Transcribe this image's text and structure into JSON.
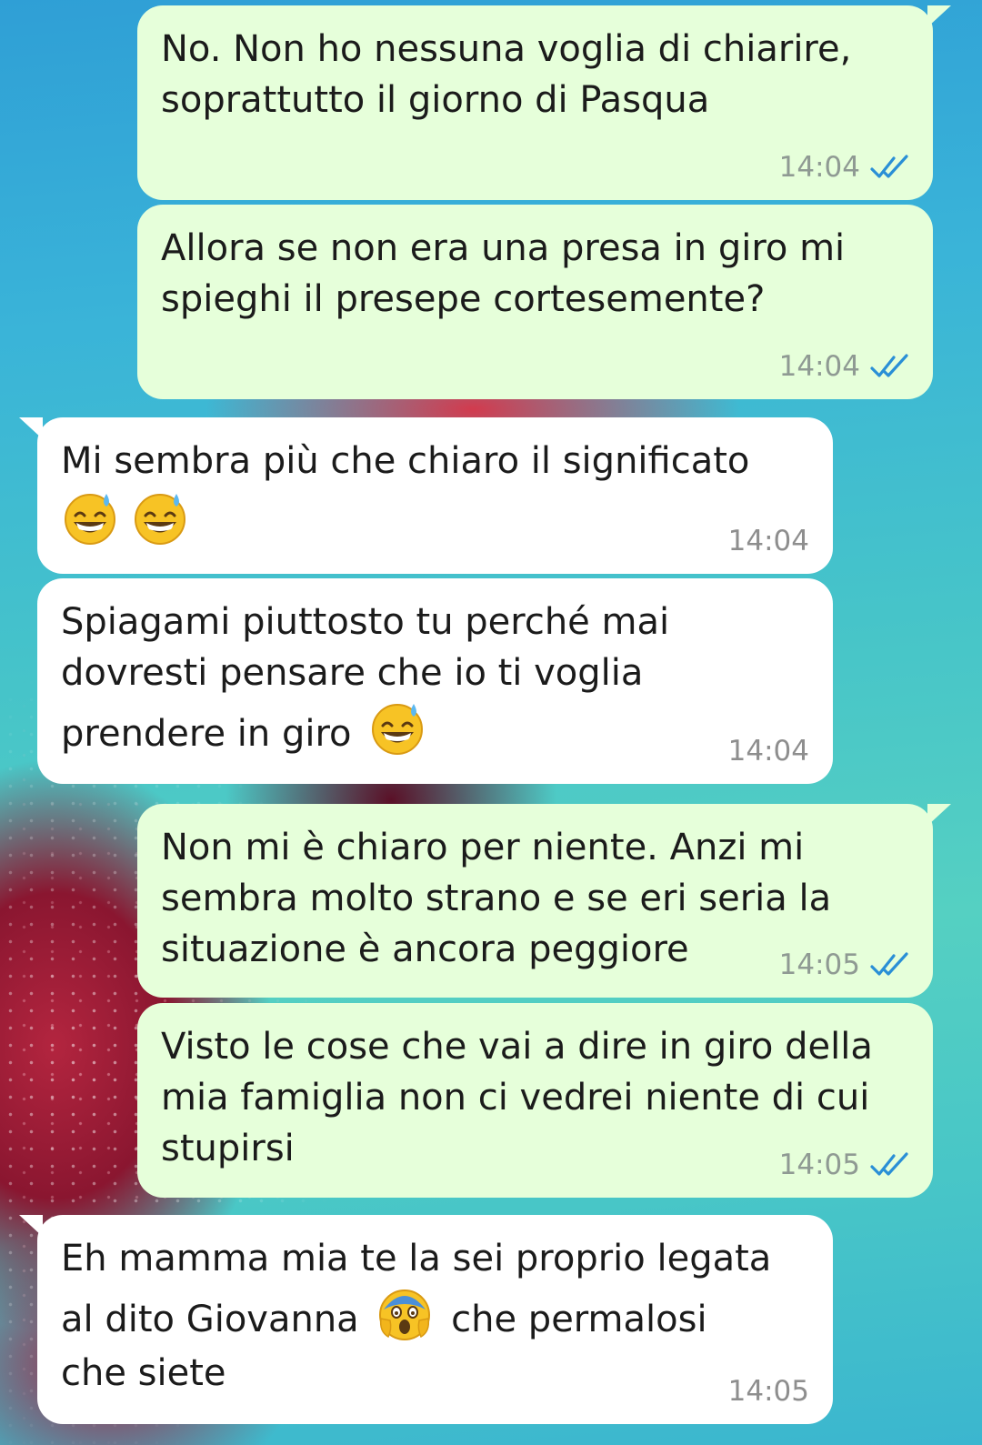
{
  "colors": {
    "outgoing_bubble": "#e6ffda",
    "incoming_bubble": "#ffffff",
    "read_ticks": "#2a8fd6",
    "timestamp": "#8f9a93"
  },
  "messages": [
    {
      "direction": "outgoing",
      "text": "No. Non ho nessuna voglia di chiarire, soprattutto il giorno di Pasqua",
      "time": "14:04",
      "status_icon": "double-check-read-icon"
    },
    {
      "direction": "outgoing",
      "text": "Allora se non era una presa in giro mi spieghi il presepe cortesemente?",
      "time": "14:04",
      "status_icon": "double-check-read-icon"
    },
    {
      "direction": "incoming",
      "text": "Mi sembra più che chiaro il significato",
      "emoji": [
        "grinning-sweat-emoji",
        "grinning-sweat-emoji"
      ],
      "time": "14:04"
    },
    {
      "direction": "incoming",
      "text_line1": "Spiagami piuttosto tu perché mai",
      "text_line2": "dovresti pensare che io ti voglia",
      "text_line3": "prendere in giro",
      "emoji": [
        "grinning-sweat-emoji"
      ],
      "time": "14:04"
    },
    {
      "direction": "outgoing",
      "text": "Non mi è chiaro per niente. Anzi mi sembra molto strano e se eri seria la situazione è ancora peggiore",
      "time": "14:05",
      "status_icon": "double-check-read-icon"
    },
    {
      "direction": "outgoing",
      "text": "Visto le cose che vai a dire in giro della mia famiglia non ci vedrei niente di cui stupirsi",
      "time": "14:05",
      "status_icon": "double-check-read-icon"
    },
    {
      "direction": "incoming",
      "text_line1": "Eh mamma mia te la sei proprio legata",
      "text_line2a": "al dito Giovanna",
      "emoji": [
        "face-screaming-in-fear-emoji"
      ],
      "text_line2b": "che permalosi",
      "text_line3": "che siete",
      "time": "14:05"
    }
  ]
}
